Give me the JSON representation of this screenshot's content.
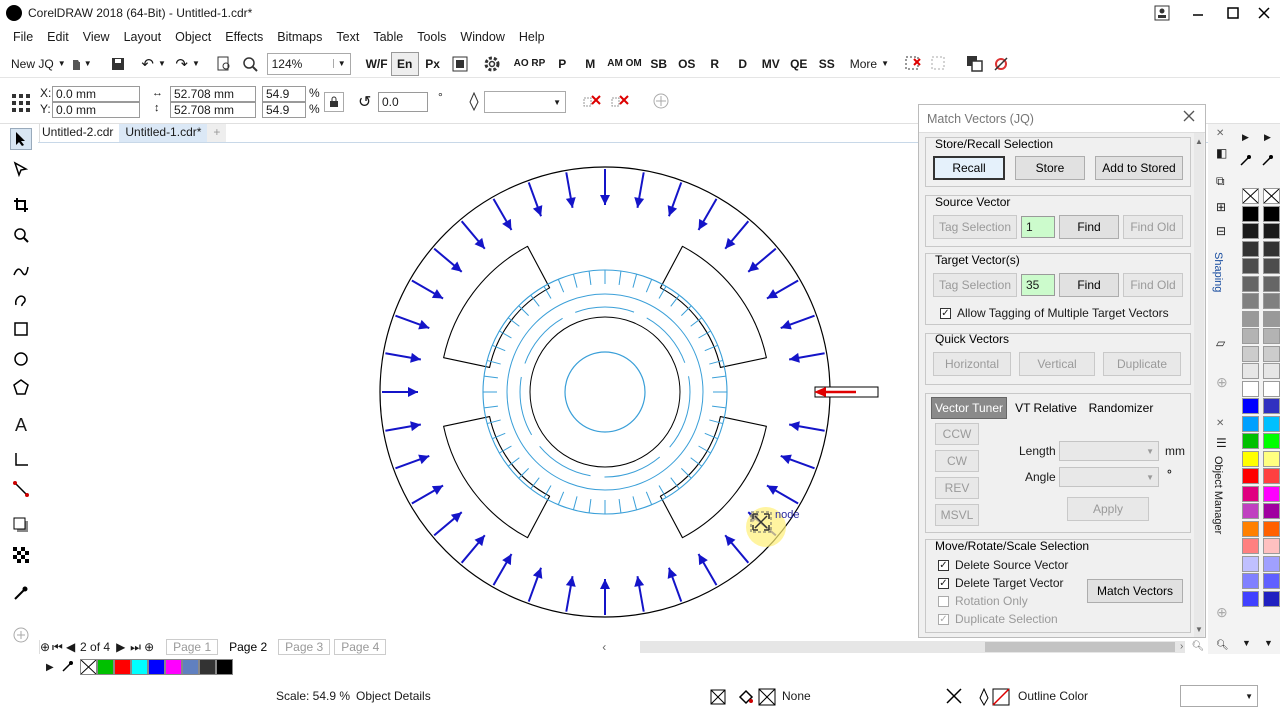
{
  "window": {
    "title": "CorelDRAW 2018 (64-Bit) - Untitled-1.cdr*"
  },
  "menu": [
    "File",
    "Edit",
    "View",
    "Layout",
    "Object",
    "Effects",
    "Bitmaps",
    "Text",
    "Table",
    "Tools",
    "Window",
    "Help"
  ],
  "toolbar": {
    "new_label": "New JQ",
    "zoom_value": "124%",
    "macro_buttons": [
      "W/F",
      "En",
      "Px",
      "AO RP",
      "P",
      "M",
      "AM OM",
      "SB",
      "OS",
      "R",
      "D",
      "MV",
      "QE",
      "SS"
    ],
    "more_label": "More"
  },
  "propbar": {
    "x_label": "X:",
    "x_value": "0.0 mm",
    "y_label": "Y:",
    "y_value": "0.0 mm",
    "w_value": "52.708 mm",
    "h_value": "52.708 mm",
    "sx_value": "54.9",
    "sy_value": "54.9",
    "pct": "%",
    "rotation_value": "0.0",
    "deg": "°"
  },
  "doc_tabs": [
    "Untitled-2.cdr",
    "Untitled-1.cdr*"
  ],
  "active_doc_tab": 1,
  "canvas": {
    "node_label": "node"
  },
  "pagenav": {
    "current": "2",
    "of": "of",
    "total": "4",
    "pages": [
      "Page 1",
      "Page 2",
      "Page 3",
      "Page 4"
    ],
    "active_page": 1
  },
  "status": {
    "scale": "Scale: 54.9 %",
    "details": "Object Details",
    "fill": "None",
    "outline": "Outline Color"
  },
  "docker": {
    "title": "Match Vectors (JQ)",
    "store_recall": {
      "label": "Store/Recall Selection",
      "recall": "Recall",
      "store": "Store",
      "add": "Add to Stored"
    },
    "source": {
      "label": "Source Vector",
      "tag": "Tag Selection",
      "value": "1",
      "find": "Find",
      "find_old": "Find Old"
    },
    "target": {
      "label": "Target Vector(s)",
      "tag": "Tag Selection",
      "value": "35",
      "find": "Find",
      "find_old": "Find Old",
      "allow": "Allow Tagging of Multiple Target Vectors"
    },
    "quick": {
      "label": "Quick Vectors",
      "horizontal": "Horizontal",
      "vertical": "Vertical",
      "duplicate": "Duplicate"
    },
    "tuner": {
      "tab1": "Vector Tuner",
      "tab2": "VT Relative",
      "tab3": "Randomizer",
      "ccw": "CCW",
      "cw": "CW",
      "rev": "REV",
      "msvl": "MSVL",
      "length": "Length",
      "mm": "mm",
      "angle": "Angle",
      "deg": "°",
      "apply": "Apply"
    },
    "move": {
      "label": "Move/Rotate/Scale Selection",
      "del_src": "Delete Source Vector",
      "del_tgt": "Delete Target Vector",
      "rot_only": "Rotation Only",
      "dup_sel": "Duplicate Selection",
      "match": "Match Vectors"
    }
  },
  "side_tabs": {
    "shaping": "Shaping",
    "object_manager": "Object Manager"
  },
  "colors": {
    "arrow": "#1414c8",
    "inner": "#3a9fd8",
    "accent_red": "#e00000",
    "tag_green": "#ccfbcc"
  }
}
